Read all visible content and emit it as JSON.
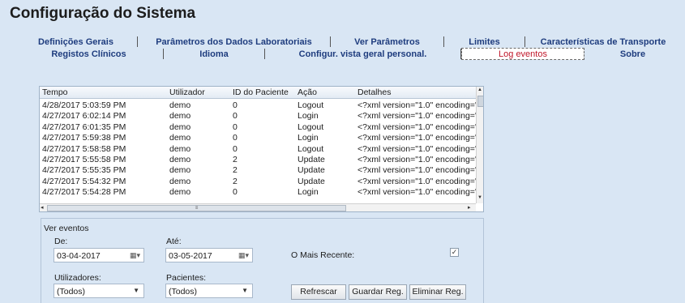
{
  "window": {
    "title": "Configuração do Sistema"
  },
  "tabs": {
    "row1": [
      "Definições Gerais",
      "Parâmetros dos Dados Laboratoriais",
      "Ver Parâmetros",
      "Limites",
      "Características de Transporte"
    ],
    "row2": [
      "Registos Clínicos",
      "Idioma",
      "Configur. vista geral personal.",
      "Log eventos",
      "Sobre"
    ],
    "active": "Log eventos"
  },
  "grid": {
    "columns": [
      "Tempo",
      "Utilizador",
      "ID do Paciente",
      "Ação",
      "Detalhes"
    ],
    "rows": [
      [
        "4/28/2017 5:03:59 PM",
        "demo",
        "0",
        "Logout",
        "<?xml version=\"1.0\" encoding='"
      ],
      [
        "4/27/2017 6:02:14 PM",
        "demo",
        "0",
        "Login",
        "<?xml version=\"1.0\" encoding='"
      ],
      [
        "4/27/2017 6:01:35 PM",
        "demo",
        "0",
        "Logout",
        "<?xml version=\"1.0\" encoding='"
      ],
      [
        "4/27/2017 5:59:38 PM",
        "demo",
        "0",
        "Login",
        "<?xml version=\"1.0\" encoding='"
      ],
      [
        "4/27/2017 5:58:58 PM",
        "demo",
        "0",
        "Logout",
        "<?xml version=\"1.0\" encoding='"
      ],
      [
        "4/27/2017 5:55:58 PM",
        "demo",
        "2",
        "Update",
        "<?xml version=\"1.0\" encoding='"
      ],
      [
        "4/27/2017 5:55:35 PM",
        "demo",
        "2",
        "Update",
        "<?xml version=\"1.0\" encoding='"
      ],
      [
        "4/27/2017 5:54:32 PM",
        "demo",
        "2",
        "Update",
        "<?xml version=\"1.0\" encoding='"
      ],
      [
        "4/27/2017 5:54:28 PM",
        "demo",
        "0",
        "Login",
        "<?xml version=\"1.0\" encoding='"
      ]
    ]
  },
  "events": {
    "legend": "Ver eventos",
    "from_label": "De:",
    "from_value": "03-04-2017",
    "to_label": "Até:",
    "to_value": "03-05-2017",
    "recent_label": "O Mais Recente:",
    "recent_checked": true,
    "users_label": "Utilizadores:",
    "users_value": "(Todos)",
    "patients_label": "Pacientes:",
    "patients_value": "(Todos)",
    "refresh": "Refrescar",
    "save": "Guardar Reg.",
    "delete": "Eliminar Reg."
  },
  "icons": {
    "calendar": "calendar-icon",
    "dropdown": "chevron-down-icon",
    "check": "checkmark-icon"
  }
}
